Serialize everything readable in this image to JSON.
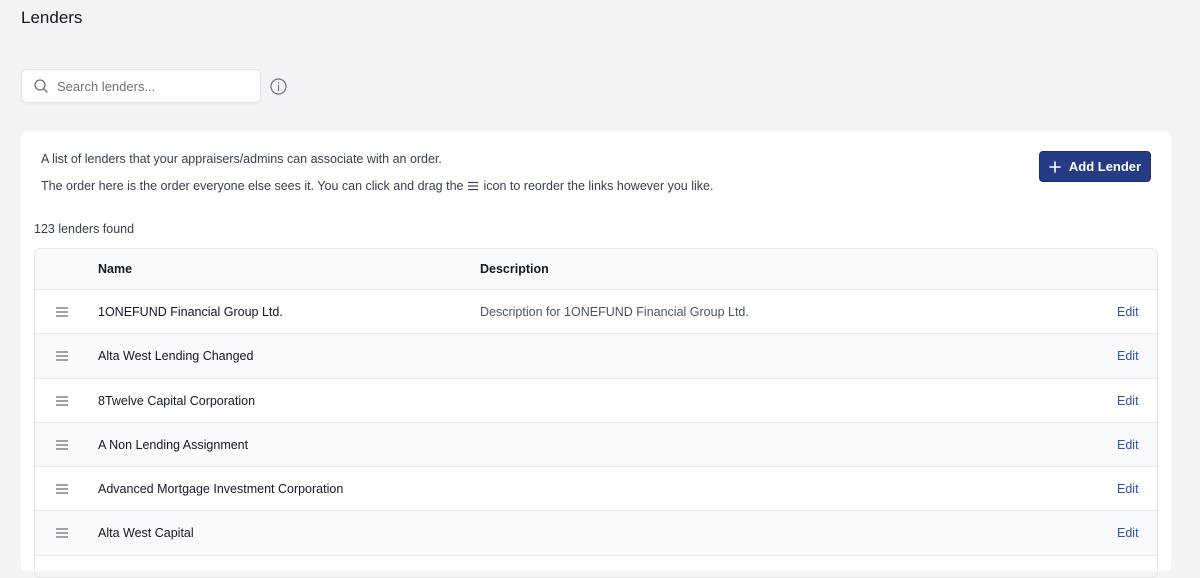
{
  "page": {
    "title": "Lenders"
  },
  "search": {
    "placeholder": "Search lenders..."
  },
  "intro": {
    "line1": "A list of lenders that your appraisers/admins can associate with an order.",
    "line2_before": "The order here is the order everyone else sees it. You can click and drag the",
    "line2_after": "icon to reorder the links however you like."
  },
  "actions": {
    "add_label": "Add Lender"
  },
  "results": {
    "count_text": "123 lenders found"
  },
  "table": {
    "headers": {
      "name": "Name",
      "description": "Description"
    },
    "edit_label": "Edit",
    "rows": [
      {
        "name": "1ONEFUND Financial Group Ltd.",
        "description": "Description for 1ONEFUND Financial Group Ltd."
      },
      {
        "name": "Alta West Lending Changed",
        "description": ""
      },
      {
        "name": "8Twelve Capital Corporation",
        "description": ""
      },
      {
        "name": "A Non Lending Assignment",
        "description": ""
      },
      {
        "name": "Advanced Mortgage Investment Corporation",
        "description": ""
      },
      {
        "name": "Alta West Capital",
        "description": ""
      }
    ]
  },
  "colors": {
    "accent": "#243b86",
    "link": "#2b4fb5",
    "background": "#f3f4f6"
  }
}
